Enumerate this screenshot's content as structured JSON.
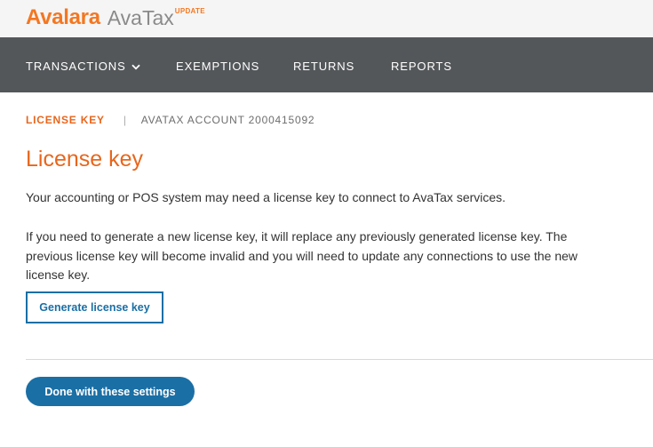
{
  "header": {
    "brand": "Avalara",
    "product": "AvaTax",
    "product_tag": "UPDATE"
  },
  "nav": {
    "items": [
      {
        "label": "TRANSACTIONS",
        "icon": "chevron-down-icon"
      },
      {
        "label": "EXEMPTIONS"
      },
      {
        "label": "RETURNS"
      },
      {
        "label": "REPORTS"
      }
    ]
  },
  "breadcrumb": {
    "current": "LICENSE KEY",
    "separator": "|",
    "account": "AVATAX ACCOUNT 2000415092"
  },
  "main": {
    "title": "License key",
    "intro": "Your accounting or POS system may need a license key to connect to AvaTax services.",
    "warning": "If you need to generate a new license key, it will replace any previously generated license key. The previous license key will become invalid and you will need to update any connections to use the new license key.",
    "generate_button": "Generate license key",
    "done_button": "Done with these settings"
  },
  "colors": {
    "brand_orange": "#e8661c",
    "nav_bg": "#54575a",
    "primary_blue": "#1a6fa5"
  }
}
